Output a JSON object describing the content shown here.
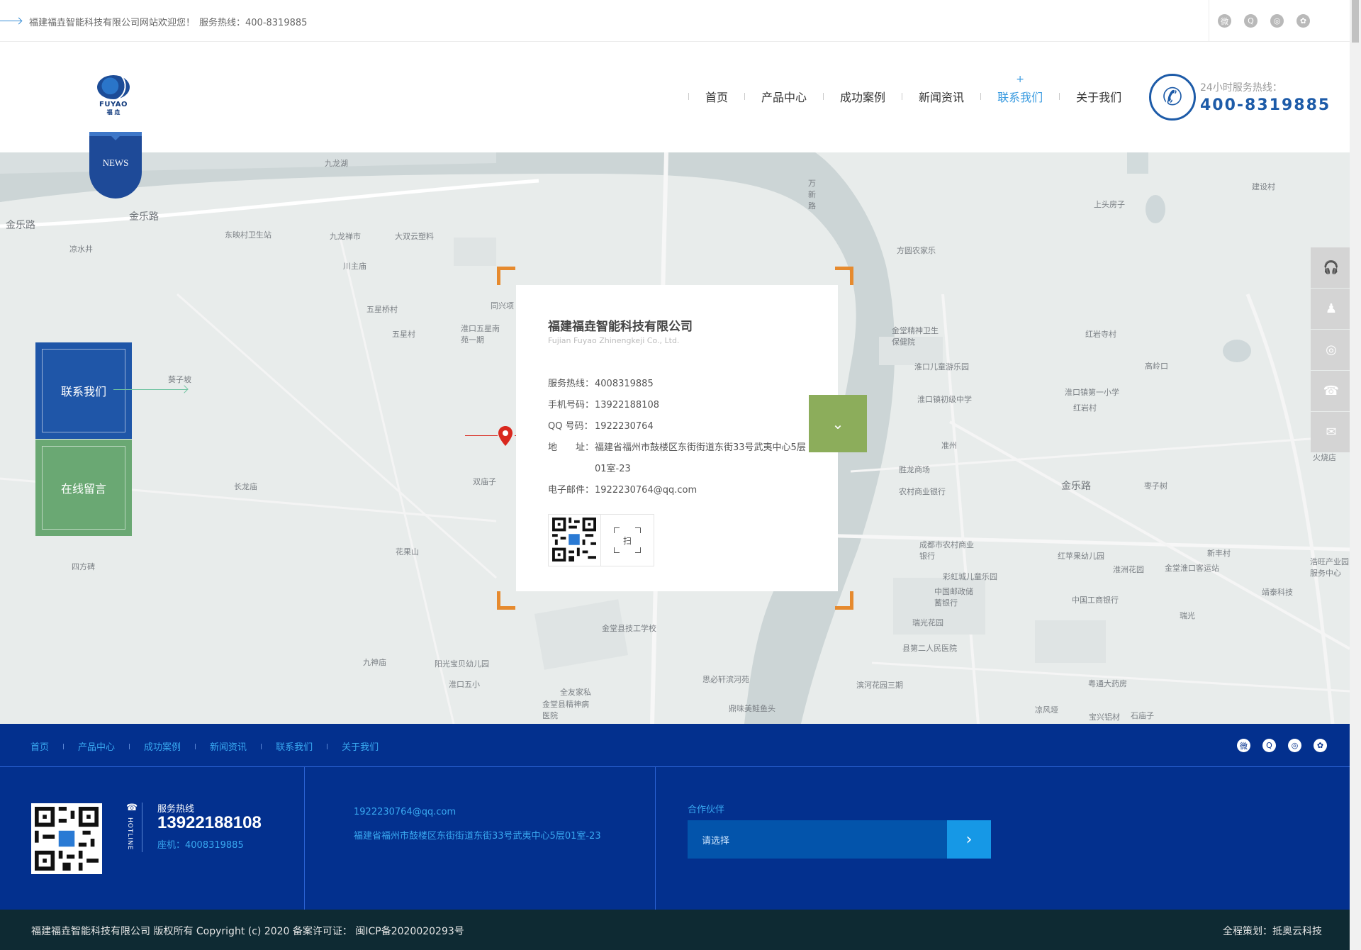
{
  "topbar": {
    "welcome": "福建福垚智能科技有限公司网站欢迎您！",
    "hotline": "服务热线：400-8319885",
    "social": [
      "weibo-icon",
      "qq-icon",
      "wechat-icon",
      "baidu-icon"
    ]
  },
  "header": {
    "logo_text": "FUYAO",
    "logo_cn": "福 垚",
    "nav": [
      "首页",
      "产品中心",
      "成功案例",
      "新闻资讯",
      "联系我们",
      "关于我们"
    ],
    "active_nav": "联系我们",
    "hotline_label": "24小时服务热线：",
    "hotline_number": "400-8319885"
  },
  "news_badge": "NEWS",
  "map": {
    "side_buttons": {
      "contact": "联系我们",
      "message": "在线留言"
    },
    "labels": [
      "九龙湖",
      "金乐路",
      "金乐路",
      "凉水井",
      "东映村卫生站",
      "九龙禅市",
      "大双云塑料",
      "川主庙",
      "五星桥村",
      "五星村",
      "淮口五星南苑一期",
      "同兴项",
      "葵子坡",
      "长龙庙",
      "双庙子",
      "花果山",
      "四方碑",
      "九神庙",
      "阳光宝贝幼儿园",
      "淮口五小",
      "金堂县技工学校",
      "全友家私",
      "金堂县精神病医院",
      "思必轩滨河苑",
      "鼎味美鲑鱼头",
      "万新路",
      "方圆农家乐",
      "建设村",
      "上头房子",
      "金堂精神卫生保健院",
      "淮口儿童游乐园",
      "淮口镇初级中学",
      "淮口镇第一小学",
      "红岩村",
      "红岩寺村",
      "高岭口",
      "准州",
      "胜龙商场",
      "农村商业银行",
      "金乐路",
      "枣子树",
      "成都市农村商业银行",
      "彩虹城儿童乐园",
      "中国邮政储蓄银行",
      "瑞光花园",
      "县第二人民医院",
      "滨河花园三期",
      "红苹果幼儿园",
      "淮洲花园",
      "中国工商银行",
      "金堂淮口客运站",
      "新丰村",
      "瑞光",
      "粤通大药房",
      "凉风垭",
      "宝兴铝材",
      "石庙子",
      "靖泰科技",
      "浩旺产业园服务中心",
      "火烧店"
    ],
    "card": {
      "name": "福建福垚智能科技有限公司",
      "en": "Fujian Fuyao Zhinengkeji Co., Ltd.",
      "rows": [
        {
          "k": "服务热线：",
          "v": "4008319885"
        },
        {
          "k": "手机号码：",
          "v": "13922188108"
        },
        {
          "k": "QQ 号码：",
          "v": "1922230764"
        },
        {
          "k": "地　　址：",
          "v": "福建省福州市鼓楼区东街街道东街33号武夷中心5层01室-23"
        },
        {
          "k": "电子邮件：",
          "v": "1922230764@qq.com"
        }
      ],
      "scan_label": "扫"
    },
    "float_icons": [
      "headset-icon",
      "qq-icon",
      "wechat-icon",
      "phone-icon",
      "message-icon"
    ]
  },
  "footer": {
    "nav": [
      "首页",
      "产品中心",
      "成功案例",
      "新闻资讯",
      "联系我们",
      "关于我们"
    ],
    "social": [
      "weibo-icon",
      "qq-icon",
      "wechat-icon",
      "baidu-icon"
    ],
    "hotline_vertical": "HOTLINE",
    "hot_title": "服务热线",
    "hot_mobile": "13922188108",
    "hot_tel": "座机：4008319885",
    "email": "1922230764@qq.com",
    "address": "福建省福州市鼓楼区东街街道东街33号武夷中心5层01室-23",
    "partner_title": "合作伙伴",
    "partner_placeholder": "请选择",
    "copyright": "福建福垚智能科技有限公司 版权所有 Copyright (c) 2020 备案许可证：  闽ICP备2020020293号",
    "credit": "全程策划：抵奥云科技"
  },
  "colors": {
    "brand": "#1d5ba8",
    "footer": "#03308e",
    "accent": "#3a9be0",
    "corner": "#e68a2e",
    "green": "#8cad5b"
  }
}
